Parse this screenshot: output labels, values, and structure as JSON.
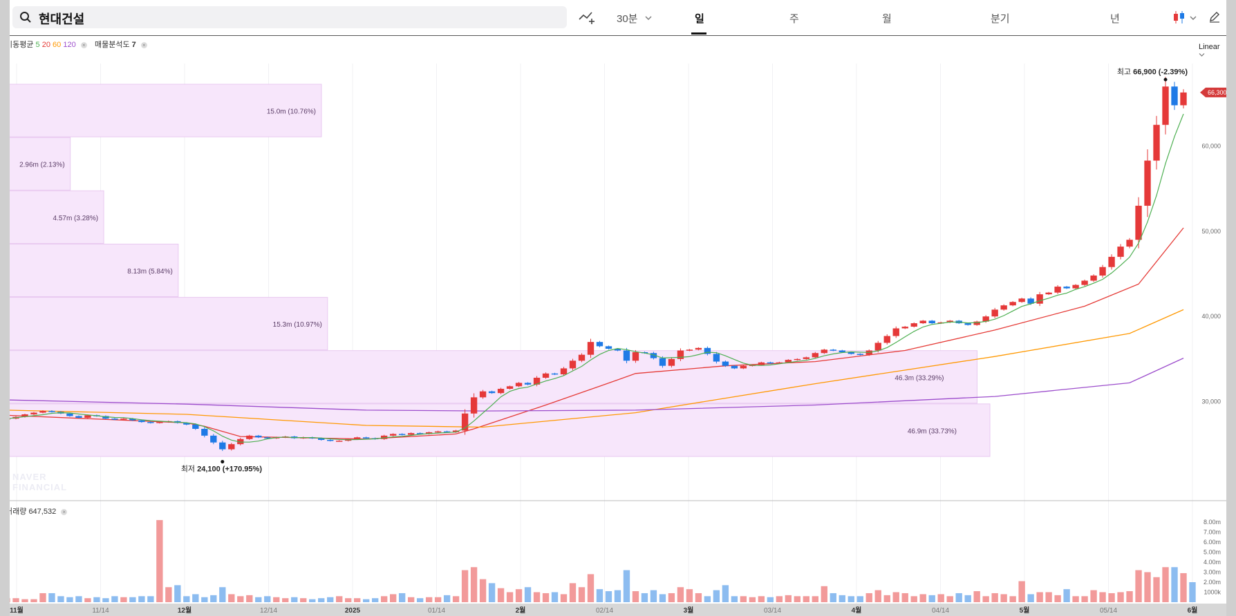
{
  "search": {
    "query": "현대건설"
  },
  "toolbar": {
    "interval": "30분",
    "tabs": [
      "일",
      "주",
      "월",
      "분기",
      "년"
    ],
    "active_tab": "일"
  },
  "legend": {
    "ma_label": "이동평균",
    "ma_periods": [
      "5",
      "20",
      "60",
      "120"
    ],
    "ma_colors": [
      "#4caf50",
      "#e53935",
      "#ff9800",
      "#9c4dcc"
    ],
    "vp_label": "매물분석도",
    "vp_value": "7",
    "volume_label": "거래량",
    "volume_value": "647,532"
  },
  "scale_mode": "Linear",
  "watermark": [
    "NAVER",
    "FINANCIAL"
  ],
  "colors": {
    "up": "#e53939",
    "down": "#1e7ae6",
    "vol_up": "#f29a9a",
    "vol_down": "#8cbcf0",
    "profile": "#f7e6fb",
    "profile_border": "#e8c8f0"
  },
  "chart_data": [
    {
      "type": "candlestick",
      "y_axis": {
        "ticks": [
          30000,
          40000,
          50000,
          60000
        ],
        "tick_labels": [
          "30,000",
          "40,000",
          "50,000",
          "60,000"
        ],
        "range": [
          22500,
          69700
        ]
      },
      "x_axis": {
        "tick_labels": [
          "11월",
          "11/14",
          "12월",
          "12/14",
          "2025",
          "01/14",
          "2월",
          "02/14",
          "3월",
          "03/14",
          "4월",
          "04/14",
          "5월",
          "05/14",
          "6월"
        ]
      },
      "last_price_label": "66,300",
      "high": {
        "label": "최고",
        "value": "66,900",
        "change": "(-2.39%)"
      },
      "low": {
        "label": "최저",
        "value": "24,100",
        "change": "(+170.95%)"
      },
      "close_series": [
        28000,
        28200,
        28500,
        28700,
        28900,
        28800,
        28600,
        28300,
        28100,
        28400,
        28300,
        28000,
        27900,
        28000,
        27800,
        27600,
        27500,
        27600,
        27700,
        27500,
        27300,
        26800,
        26000,
        25200,
        24400,
        25000,
        25600,
        26000,
        25800,
        25700,
        25800,
        25900,
        25700,
        25800,
        25700,
        25500,
        25400,
        25400,
        25600,
        25800,
        25700,
        25600,
        26000,
        26200,
        26100,
        26300,
        26200,
        26400,
        26500,
        26400,
        26600,
        28600,
        30500,
        31200,
        31000,
        31500,
        31800,
        32200,
        32000,
        32800,
        33300,
        33200,
        33900,
        34800,
        35500,
        37000,
        36500,
        36200,
        36000,
        34800,
        35800,
        35700,
        35100,
        34200,
        35000,
        36000,
        36100,
        36300,
        35600,
        34700,
        34200,
        33900,
        34200,
        34300,
        34600,
        34500,
        34600,
        34900,
        35000,
        35200,
        35700,
        36100,
        36000,
        35800,
        35600,
        35500,
        36000,
        36900,
        37700,
        38600,
        38800,
        39200,
        39500,
        39200,
        39300,
        39500,
        39200,
        39000,
        39400,
        40000,
        40800,
        41300,
        41700,
        42100,
        41500,
        42600,
        42800,
        43500,
        43300,
        43700,
        44200,
        44800,
        45800,
        47000,
        48200,
        49000,
        53000,
        58300,
        62500,
        67000,
        64800,
        66300
      ],
      "ma": [
        {
          "period": 20,
          "color": "#e53935",
          "points": [
            [
              0,
              28400
            ],
            [
              20,
              27500
            ],
            [
              22,
              27100
            ],
            [
              26,
              25900
            ],
            [
              40,
              25600
            ],
            [
              50,
              26200
            ],
            [
              52,
              26800
            ],
            [
              60,
              29600
            ],
            [
              66,
              31800
            ],
            [
              70,
              33300
            ],
            [
              80,
              34200
            ],
            [
              90,
              34700
            ],
            [
              100,
              36000
            ],
            [
              110,
              38400
            ],
            [
              120,
              41200
            ],
            [
              126,
              43800
            ],
            [
              131,
              50400
            ]
          ]
        },
        {
          "period": 60,
          "color": "#ff9800",
          "points": [
            [
              0,
              29000
            ],
            [
              20,
              28500
            ],
            [
              40,
              27200
            ],
            [
              53,
              27000
            ],
            [
              70,
              28700
            ],
            [
              90,
              32100
            ],
            [
              110,
              35300
            ],
            [
              125,
              38000
            ],
            [
              131,
              40800
            ]
          ]
        },
        {
          "period": 120,
          "color": "#9c4dcc",
          "points": [
            [
              0,
              30200
            ],
            [
              20,
              29700
            ],
            [
              40,
              29000
            ],
            [
              53,
              28900
            ],
            [
              70,
              29000
            ],
            [
              90,
              29600
            ],
            [
              110,
              30600
            ],
            [
              125,
              32200
            ],
            [
              131,
              35100
            ]
          ]
        }
      ],
      "volume_profile": [
        {
          "label": "46.9m (33.73%)",
          "pct": 33.73
        },
        {
          "label": "46.3m (33.29%)",
          "pct": 33.29
        },
        {
          "label": "15.3m (10.97%)",
          "pct": 10.97
        },
        {
          "label": "8.13m (5.84%)",
          "pct": 5.84
        },
        {
          "label": "4.57m (3.28%)",
          "pct": 3.28
        },
        {
          "label": "2.96m (2.13%)",
          "pct": 2.13
        },
        {
          "label": "15.0m (10.76%)",
          "pct": 10.76
        }
      ]
    },
    {
      "type": "bar",
      "series": [
        {
          "values": [
            0.4,
            0.4,
            0.3,
            0.3,
            0.9,
            0.9,
            0.6,
            0.5,
            0.6,
            0.4,
            0.5,
            0.4,
            0.6,
            0.5,
            0.5,
            0.6,
            0.6,
            8.2,
            1.5,
            1.7,
            0.6,
            0.8,
            0.5,
            0.7,
            1.5,
            0.8,
            0.6,
            0.7,
            0.5,
            0.6,
            0.5,
            0.4,
            0.5,
            0.4,
            0.3,
            0.4,
            0.5,
            0.6,
            0.4,
            0.4,
            0.3,
            0.4,
            0.6,
            0.8,
            0.9,
            0.5,
            0.4,
            0.5,
            0.5,
            0.7,
            0.6,
            3.2,
            3.5,
            2.3,
            1.9,
            1.4,
            1.0,
            1.3,
            1.5,
            1.0,
            0.9,
            1.0,
            0.8,
            1.9,
            1.5,
            2.8,
            1.3,
            1.1,
            1.2,
            3.2,
            1.1,
            0.9,
            1.2,
            0.8,
            0.9,
            1.5,
            1.3,
            0.9,
            0.6,
            1.2,
            1.7,
            0.6,
            0.6,
            0.5,
            0.6,
            0.5,
            0.6,
            0.7,
            0.6,
            0.6,
            0.6,
            1.6,
            0.9,
            0.7,
            0.6,
            0.6,
            0.9,
            1.2,
            0.7,
            1.0,
            0.9,
            0.6,
            0.8,
            0.7,
            0.8,
            0.6,
            0.9,
            0.7,
            1.1,
            0.6,
            0.9,
            0.8,
            0.6,
            2.1,
            0.8,
            1.0,
            1.0,
            0.7,
            1.3,
            0.6,
            0.6,
            1.2,
            1.0,
            0.9,
            1.0,
            1.1,
            3.2,
            3.0,
            2.5,
            3.5,
            3.5,
            2.9,
            2.0
          ]
        }
      ],
      "y_axis": {
        "tick_labels": [
          "1000k",
          "2.00m",
          "3.00m",
          "4.00m",
          "5.00m",
          "6.00m",
          "7.00m",
          "8.00m"
        ]
      }
    }
  ]
}
